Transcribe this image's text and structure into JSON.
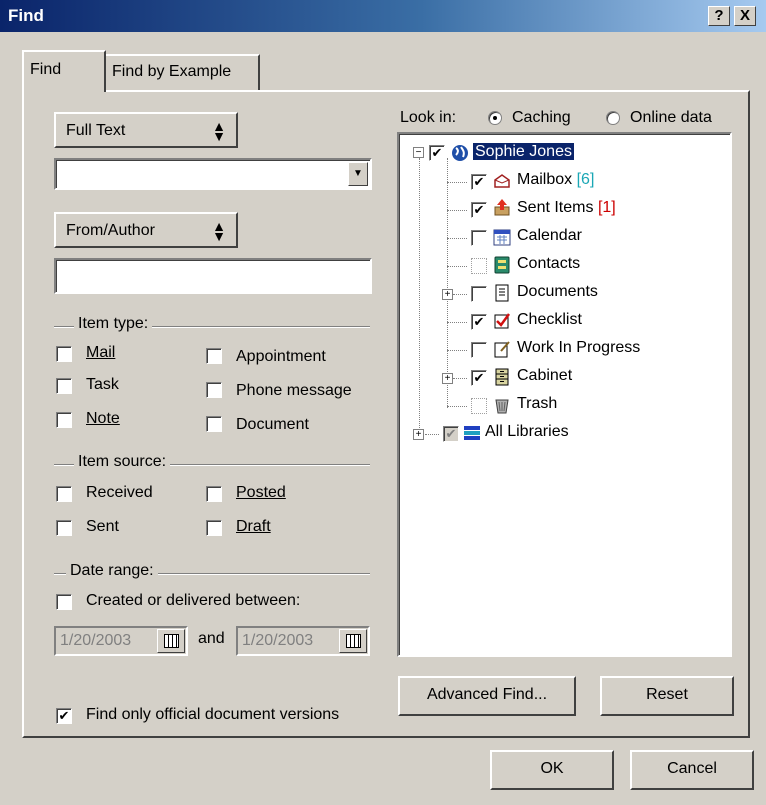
{
  "window": {
    "title": "Find",
    "help_button": "?",
    "close_button": "X"
  },
  "tabs": [
    {
      "label": "Find",
      "active": true
    },
    {
      "label": "Find by Example",
      "active": false
    }
  ],
  "search": {
    "field_selector": "Full Text",
    "text_value": "",
    "author_selector": "From/Author",
    "author_value": ""
  },
  "item_type": {
    "label": "Item type:",
    "options": [
      {
        "label": "Mail",
        "checked": false
      },
      {
        "label": "Appointment",
        "checked": false
      },
      {
        "label": "Task",
        "checked": false
      },
      {
        "label": "Phone message",
        "checked": false
      },
      {
        "label": "Note",
        "checked": false
      },
      {
        "label": "Document",
        "checked": false
      }
    ]
  },
  "item_source": {
    "label": "Item source:",
    "options": [
      {
        "label": "Received",
        "checked": false
      },
      {
        "label": "Posted",
        "checked": false
      },
      {
        "label": "Sent",
        "checked": false
      },
      {
        "label": "Draft",
        "checked": false
      }
    ]
  },
  "date_range": {
    "label": "Date range:",
    "checkbox_label": "Created or delivered between:",
    "checked": false,
    "from": "1/20/2003",
    "and_label": "and",
    "to": "1/20/2003"
  },
  "official_versions": {
    "label": "Find only official document versions",
    "checked": true
  },
  "look_in": {
    "label": "Look in:",
    "caching": "Caching",
    "online": "Online data",
    "selected": "Caching"
  },
  "tree": {
    "root": {
      "label": "Sophie Jones",
      "checked": true
    },
    "items": [
      {
        "label": "Mailbox",
        "count": "[6]",
        "checked": true,
        "icon": "mailbox-icon",
        "count_color": "#1aa7b5"
      },
      {
        "label": "Sent Items",
        "count": "[1]",
        "checked": true,
        "icon": "sent-items-icon",
        "count_color": "#cc0000"
      },
      {
        "label": "Calendar",
        "count": "",
        "checked": false,
        "icon": "calendar-icon"
      },
      {
        "label": "Contacts",
        "count": "",
        "checked": false,
        "icon": "contacts-icon"
      },
      {
        "label": "Documents",
        "count": "",
        "checked": false,
        "icon": "documents-icon"
      },
      {
        "label": "Checklist",
        "count": "",
        "checked": true,
        "icon": "checklist-icon"
      },
      {
        "label": "Work In Progress",
        "count": "",
        "checked": false,
        "icon": "work-in-progress-icon"
      },
      {
        "label": "Cabinet",
        "count": "",
        "checked": true,
        "icon": "cabinet-icon"
      },
      {
        "label": "Trash",
        "count": "",
        "checked": false,
        "icon": "trash-icon"
      }
    ],
    "libraries": {
      "label": "All Libraries",
      "checked": true
    }
  },
  "buttons": {
    "advanced_find": "Advanced Find...",
    "reset": "Reset",
    "ok": "OK",
    "cancel": "Cancel"
  },
  "colors": {
    "title_bar": "#0a246a",
    "dialog_bg": "#d4d0c8",
    "selection": "#0a246a"
  }
}
